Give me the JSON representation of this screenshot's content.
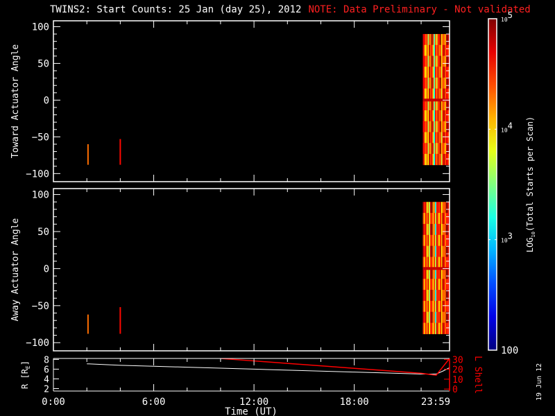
{
  "title": "TWINS2: Start Counts: 25 Jan (day  25), 2012",
  "note": "NOTE: Data Preliminary - Not validated",
  "date_stamp": "19 Jun 12",
  "colors": {
    "axis": "#ffffff",
    "note": "#ff2020",
    "lshell": "#ff0000",
    "r": "#ffffff"
  },
  "chart_data": [
    {
      "type": "heatmap",
      "ylabel": "Toward Actuator Angle",
      "ylim": [
        -111,
        108
      ],
      "yticks": [
        100,
        50,
        0,
        -50,
        -100
      ],
      "xlim": [
        0,
        23.7
      ],
      "spikes": [
        {
          "x": 2.07,
          "y0": -88,
          "y1": -60,
          "log": 4.3
        },
        {
          "x": 4.0,
          "y0": -88,
          "y1": -53,
          "log": 4.6
        }
      ],
      "block": {
        "x0": 22.1,
        "x1": 23.7,
        "y0": -88,
        "y1": 90
      },
      "column_logs": [
        4.7,
        4.4,
        4.1,
        4.5,
        3.8,
        4.6,
        4.3,
        4.8,
        4.2,
        3.3,
        4.5,
        4.0,
        4.6,
        4.4,
        4.7,
        3.9,
        4.5,
        4.6,
        4.2,
        4.7,
        4.8,
        4.5
      ]
    },
    {
      "type": "heatmap",
      "ylabel": "Away Actuator Angle",
      "ylim": [
        -111,
        108
      ],
      "yticks": [
        100,
        50,
        0,
        -50,
        -100
      ],
      "xlim": [
        0,
        23.7
      ],
      "spikes": [
        {
          "x": 2.07,
          "y0": -88,
          "y1": -62,
          "log": 4.3
        },
        {
          "x": 4.0,
          "y0": -88,
          "y1": -52,
          "log": 4.6
        }
      ],
      "block": {
        "x0": 22.1,
        "x1": 23.7,
        "y0": -88,
        "y1": 90
      },
      "column_logs": [
        4.6,
        4.3,
        4.7,
        4.0,
        4.5,
        3.7,
        4.6,
        4.8,
        4.1,
        4.4,
        3.4,
        4.6,
        4.5,
        4.2,
        4.7,
        4.0,
        4.6,
        4.5,
        4.3,
        4.8,
        4.7,
        4.6
      ]
    },
    {
      "type": "line",
      "xlabel": "Time (UT)",
      "xticks": [
        {
          "v": 0,
          "label": "0:00"
        },
        {
          "v": 6,
          "label": "6:00"
        },
        {
          "v": 12,
          "label": "12:00"
        },
        {
          "v": 18,
          "label": "18:00"
        },
        {
          "v": 23.98,
          "label": "23:59"
        }
      ],
      "xlim": [
        0,
        23.7
      ],
      "ylabel": "R [R",
      "ylabel_sub": "E",
      "ylabel_end": "]",
      "ylim": [
        1.5,
        8.2
      ],
      "yticks": [
        2,
        4,
        6,
        8
      ],
      "y2label": "L Shell",
      "y2lim": [
        -2,
        31
      ],
      "y2ticks": [
        0,
        10,
        20,
        30
      ],
      "series": [
        {
          "name": "R",
          "x": [
            2,
            4,
            6,
            8,
            10,
            12,
            14,
            16,
            18,
            20,
            22,
            22.9,
            23.3,
            23.7
          ],
          "y": [
            7.1,
            6.8,
            6.6,
            6.4,
            6.2,
            6.0,
            5.8,
            5.6,
            5.4,
            5.2,
            5.0,
            5.0,
            5.6,
            6.3
          ]
        },
        {
          "name": "L Shell",
          "x": [
            10,
            12,
            14,
            16,
            18,
            20,
            22,
            22.9,
            23.7
          ],
          "y": [
            31,
            28.5,
            26,
            23.5,
            21,
            18.5,
            16,
            14,
            31
          ]
        }
      ]
    }
  ],
  "colorbar": {
    "label": "LOG",
    "label_sub": "10",
    "label_rest": "(Total Starts per Scan)",
    "range_log": [
      2,
      5
    ],
    "ticks": [
      {
        "v": 5,
        "base": "10",
        "exp": "5"
      },
      {
        "v": 4,
        "base": "10",
        "exp": "4"
      },
      {
        "v": 3,
        "base": "10",
        "exp": "3"
      },
      {
        "v": 2,
        "base": "100",
        "exp": ""
      }
    ]
  }
}
